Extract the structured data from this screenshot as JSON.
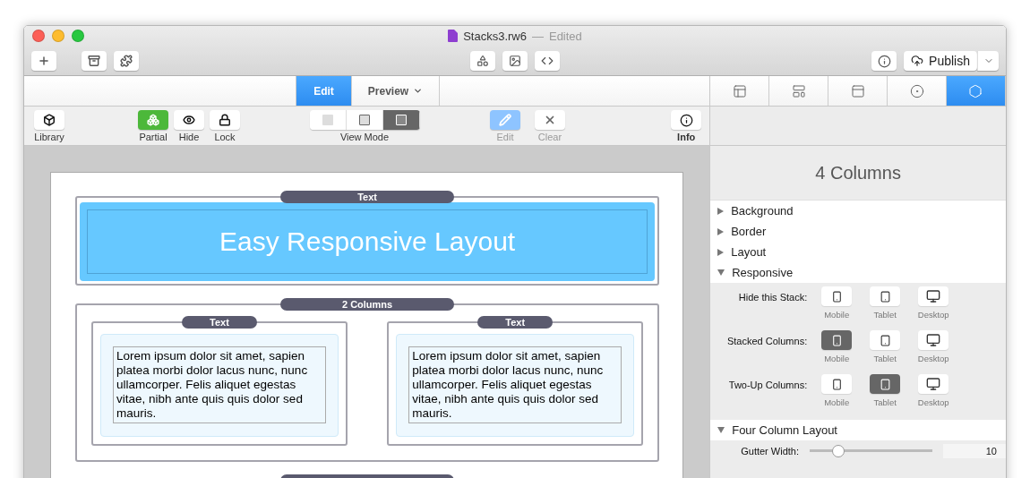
{
  "window": {
    "title": "Stacks3.rw6",
    "separator": "—",
    "status": "Edited"
  },
  "toolbar": {
    "publish": {
      "label": "Publish"
    }
  },
  "mode_tabs": [
    {
      "label": "Edit",
      "selected": true
    },
    {
      "label": "Preview",
      "selected": false
    }
  ],
  "inspector_tabs": [
    {
      "selected": false
    },
    {
      "selected": false
    },
    {
      "selected": false
    },
    {
      "selected": false
    },
    {
      "selected": true
    }
  ],
  "tools": [
    {
      "label": "Library",
      "on": false
    },
    {
      "label": "Partial",
      "on": true
    },
    {
      "label": "Hide",
      "on": false
    },
    {
      "label": "Lock",
      "on": false
    }
  ],
  "view_mode": {
    "label": "View Mode",
    "segments": [
      {
        "selected": false
      },
      {
        "selected": false
      },
      {
        "selected": true
      }
    ]
  },
  "edit_tools": [
    {
      "label": "Edit",
      "on": true,
      "disabled": true
    },
    {
      "label": "Clear",
      "on": false,
      "disabled": true
    }
  ],
  "info_tool": {
    "label": "Info"
  },
  "canvas": {
    "header": {
      "label": "Text",
      "title": "Easy Responsive Layout"
    },
    "columns_stack": {
      "label": "2 Columns",
      "columns": [
        {
          "label": "Text",
          "body": "Lorem ipsum dolor sit amet, sapien platea morbi dolor lacus nunc, nunc ullamcorper. Felis aliquet egestas vitae, nibh ante quis quis dolor sed mauris."
        },
        {
          "label": "Text",
          "body": "Lorem ipsum dolor sit amet, sapien platea morbi dolor lacus nunc, nunc ullamcorper. Felis aliquet egestas vitae, nibh ante quis quis dolor sed mauris."
        }
      ]
    }
  },
  "inspector": {
    "title": "4 Columns",
    "sections": [
      {
        "label": "Background",
        "expanded": false
      },
      {
        "label": "Border",
        "expanded": false
      },
      {
        "label": "Layout",
        "expanded": false
      },
      {
        "label": "Responsive",
        "expanded": true,
        "rows": [
          {
            "label": "Hide this Stack:",
            "devices": [
              {
                "label": "Mobile",
                "on": false
              },
              {
                "label": "Tablet",
                "on": false
              },
              {
                "label": "Desktop",
                "on": false
              }
            ]
          },
          {
            "label": "Stacked Columns:",
            "devices": [
              {
                "label": "Mobile",
                "on": true
              },
              {
                "label": "Tablet",
                "on": false
              },
              {
                "label": "Desktop",
                "on": false
              }
            ]
          },
          {
            "label": "Two-Up Columns:",
            "devices": [
              {
                "label": "Mobile",
                "on": false
              },
              {
                "label": "Tablet",
                "on": true
              },
              {
                "label": "Desktop",
                "on": false
              }
            ]
          }
        ]
      },
      {
        "label": "Four Column Layout",
        "expanded": true,
        "slider": {
          "label": "Gutter Width:",
          "level": 0.23,
          "value": "10"
        }
      }
    ]
  }
}
